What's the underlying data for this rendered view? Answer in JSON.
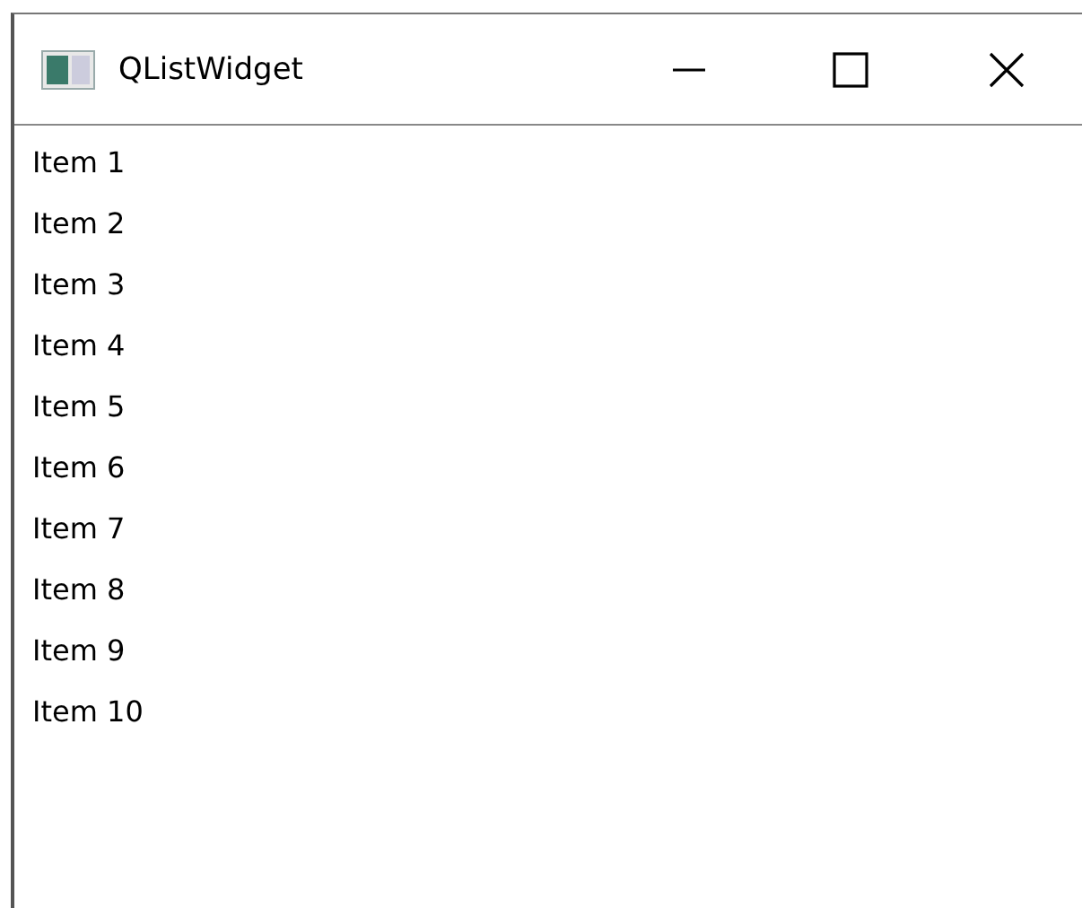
{
  "window": {
    "title": "QListWidget"
  },
  "list": {
    "items": [
      {
        "label": "Item 1"
      },
      {
        "label": "Item 2"
      },
      {
        "label": "Item 3"
      },
      {
        "label": "Item 4"
      },
      {
        "label": "Item 5"
      },
      {
        "label": "Item 6"
      },
      {
        "label": "Item 7"
      },
      {
        "label": "Item 8"
      },
      {
        "label": "Item 9"
      },
      {
        "label": "Item 10"
      }
    ]
  }
}
